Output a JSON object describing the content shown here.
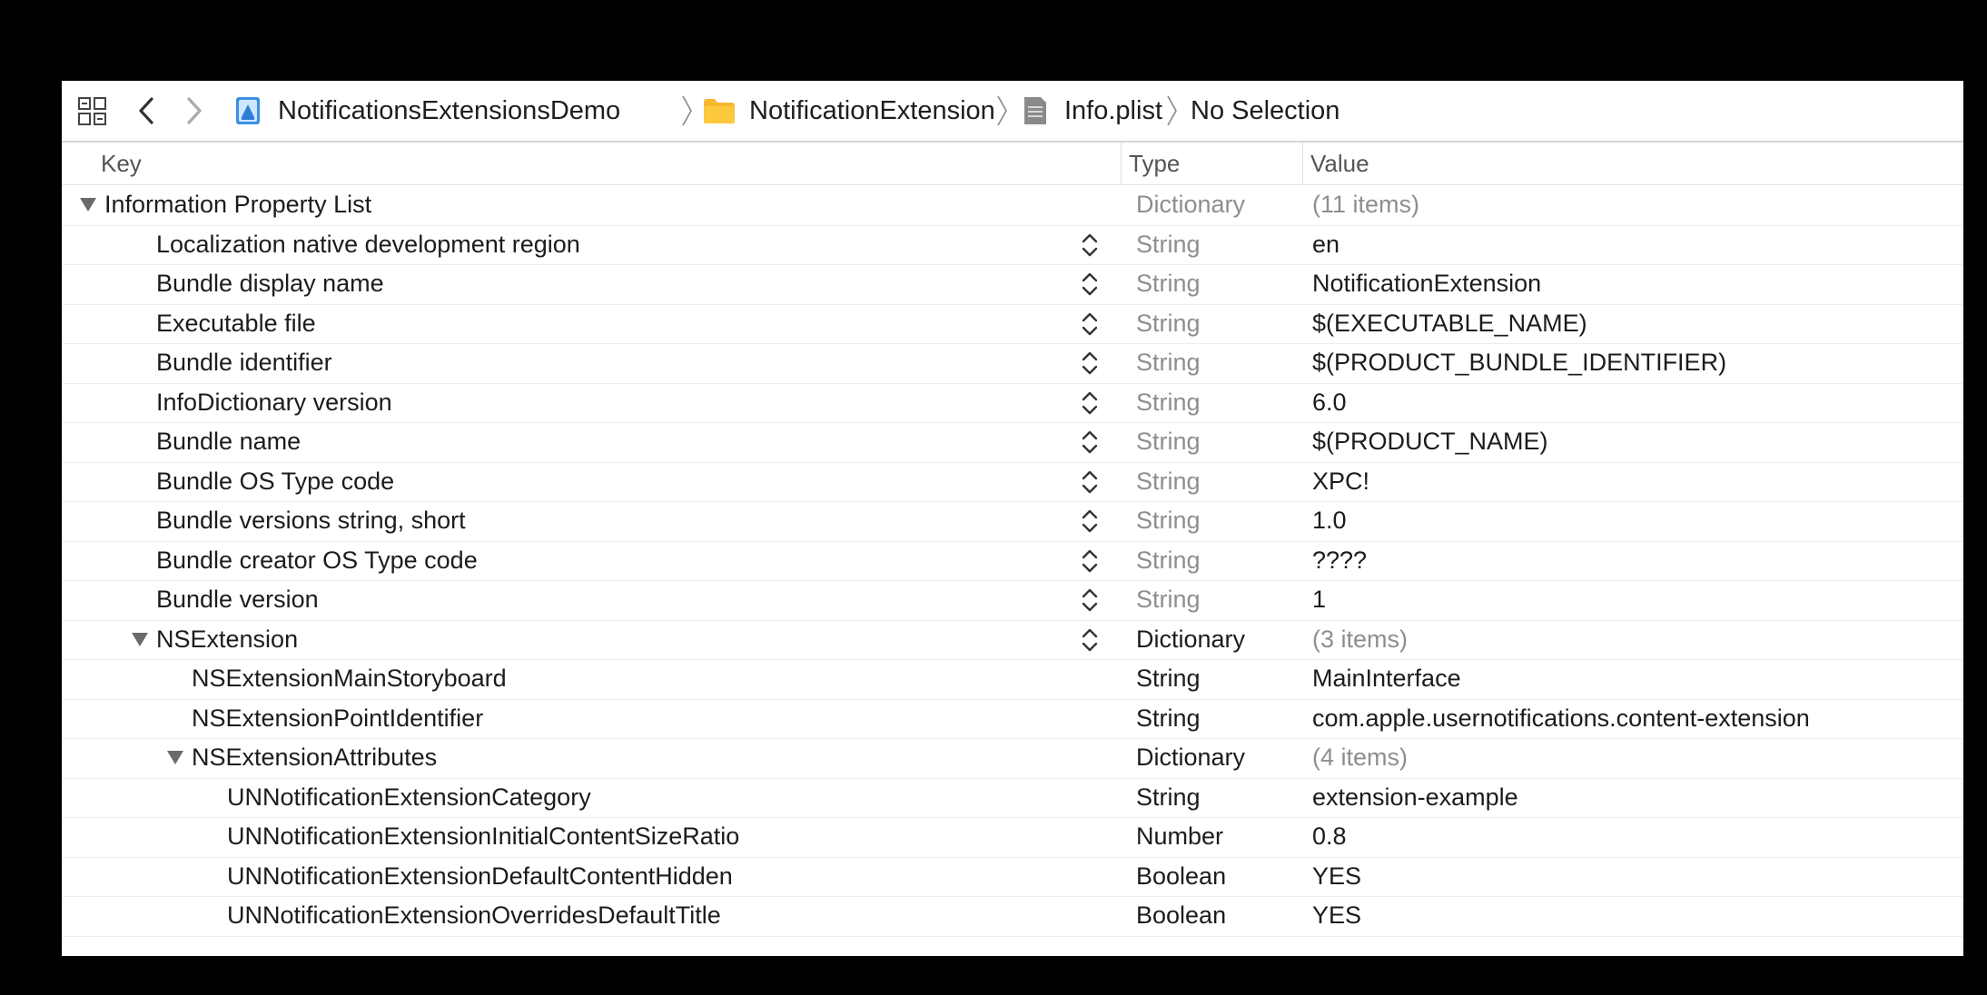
{
  "breadcrumb": {
    "project": "NotificationsExtensionsDemo",
    "folder": "NotificationExtension",
    "file": "Info.plist",
    "selection": "No Selection"
  },
  "columns": {
    "key": "Key",
    "type": "Type",
    "value": "Value"
  },
  "rows": [
    {
      "key": "Information Property List",
      "type": "Dictionary",
      "value": "(11 items)",
      "level": 0,
      "disclosure": true,
      "stepper": false,
      "dim_type": true,
      "dim_value": true
    },
    {
      "key": "Localization native development region",
      "type": "String",
      "value": "en",
      "level": 1,
      "disclosure": false,
      "stepper": true,
      "dim_type": true,
      "dim_value": false
    },
    {
      "key": "Bundle display name",
      "type": "String",
      "value": "NotificationExtension",
      "level": 1,
      "disclosure": false,
      "stepper": true,
      "dim_type": true,
      "dim_value": false
    },
    {
      "key": "Executable file",
      "type": "String",
      "value": "$(EXECUTABLE_NAME)",
      "level": 1,
      "disclosure": false,
      "stepper": true,
      "dim_type": true,
      "dim_value": false
    },
    {
      "key": "Bundle identifier",
      "type": "String",
      "value": "$(PRODUCT_BUNDLE_IDENTIFIER)",
      "level": 1,
      "disclosure": false,
      "stepper": true,
      "dim_type": true,
      "dim_value": false
    },
    {
      "key": "InfoDictionary version",
      "type": "String",
      "value": "6.0",
      "level": 1,
      "disclosure": false,
      "stepper": true,
      "dim_type": true,
      "dim_value": false
    },
    {
      "key": "Bundle name",
      "type": "String",
      "value": "$(PRODUCT_NAME)",
      "level": 1,
      "disclosure": false,
      "stepper": true,
      "dim_type": true,
      "dim_value": false
    },
    {
      "key": "Bundle OS Type code",
      "type": "String",
      "value": "XPC!",
      "level": 1,
      "disclosure": false,
      "stepper": true,
      "dim_type": true,
      "dim_value": false
    },
    {
      "key": "Bundle versions string, short",
      "type": "String",
      "value": "1.0",
      "level": 1,
      "disclosure": false,
      "stepper": true,
      "dim_type": true,
      "dim_value": false
    },
    {
      "key": "Bundle creator OS Type code",
      "type": "String",
      "value": "????",
      "level": 1,
      "disclosure": false,
      "stepper": true,
      "dim_type": true,
      "dim_value": false
    },
    {
      "key": "Bundle version",
      "type": "String",
      "value": "1",
      "level": 1,
      "disclosure": false,
      "stepper": true,
      "dim_type": true,
      "dim_value": false
    },
    {
      "key": "NSExtension",
      "type": "Dictionary",
      "value": "(3 items)",
      "level": 1,
      "disclosure": true,
      "stepper": true,
      "dim_type": false,
      "dim_value": true
    },
    {
      "key": "NSExtensionMainStoryboard",
      "type": "String",
      "value": "MainInterface",
      "level": 2,
      "disclosure": false,
      "stepper": false,
      "dim_type": false,
      "dim_value": false
    },
    {
      "key": "NSExtensionPointIdentifier",
      "type": "String",
      "value": "com.apple.usernotifications.content-extension",
      "level": 2,
      "disclosure": false,
      "stepper": false,
      "dim_type": false,
      "dim_value": false
    },
    {
      "key": "NSExtensionAttributes",
      "type": "Dictionary",
      "value": "(4 items)",
      "level": 2,
      "disclosure": true,
      "stepper": false,
      "dim_type": false,
      "dim_value": true
    },
    {
      "key": "UNNotificationExtensionCategory",
      "type": "String",
      "value": "extension-example",
      "level": 3,
      "disclosure": false,
      "stepper": false,
      "dim_type": false,
      "dim_value": false
    },
    {
      "key": "UNNotificationExtensionInitialContentSizeRatio",
      "type": "Number",
      "value": "0.8",
      "level": 3,
      "disclosure": false,
      "stepper": false,
      "dim_type": false,
      "dim_value": false
    },
    {
      "key": "UNNotificationExtensionDefaultContentHidden",
      "type": "Boolean",
      "value": "YES",
      "level": 3,
      "disclosure": false,
      "stepper": false,
      "dim_type": false,
      "dim_value": false
    },
    {
      "key": "UNNotificationExtensionOverridesDefaultTitle",
      "type": "Boolean",
      "value": "YES",
      "level": 3,
      "disclosure": false,
      "stepper": false,
      "dim_type": false,
      "dim_value": false
    }
  ]
}
